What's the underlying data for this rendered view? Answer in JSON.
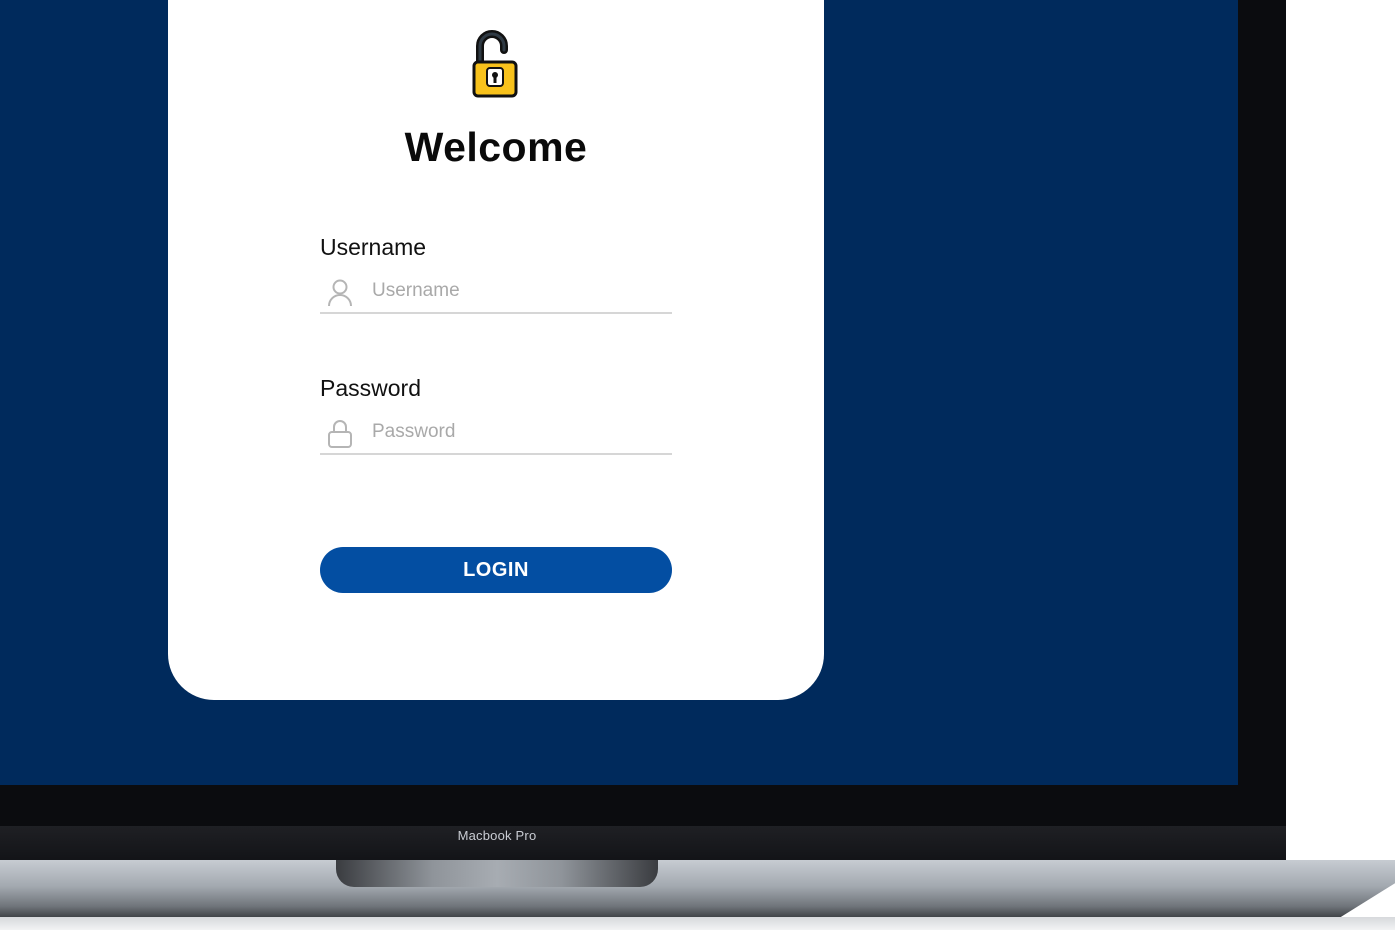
{
  "colors": {
    "screen_background": "#002a5c",
    "card_background": "#ffffff",
    "button_background": "#034ea2",
    "button_text": "#ffffff",
    "lock_body": "#f8c21c",
    "placeholder": "#a9a9a9"
  },
  "header": {
    "icon": "unlocked-padlock-icon",
    "title": "Welcome"
  },
  "form": {
    "username": {
      "label": "Username",
      "placeholder": "Username",
      "value": "",
      "icon": "user-icon"
    },
    "password": {
      "label": "Password",
      "placeholder": "Password",
      "value": "",
      "icon": "lock-icon"
    },
    "submit_label": "LOGIN"
  },
  "device": {
    "label": "Macbook Pro"
  }
}
